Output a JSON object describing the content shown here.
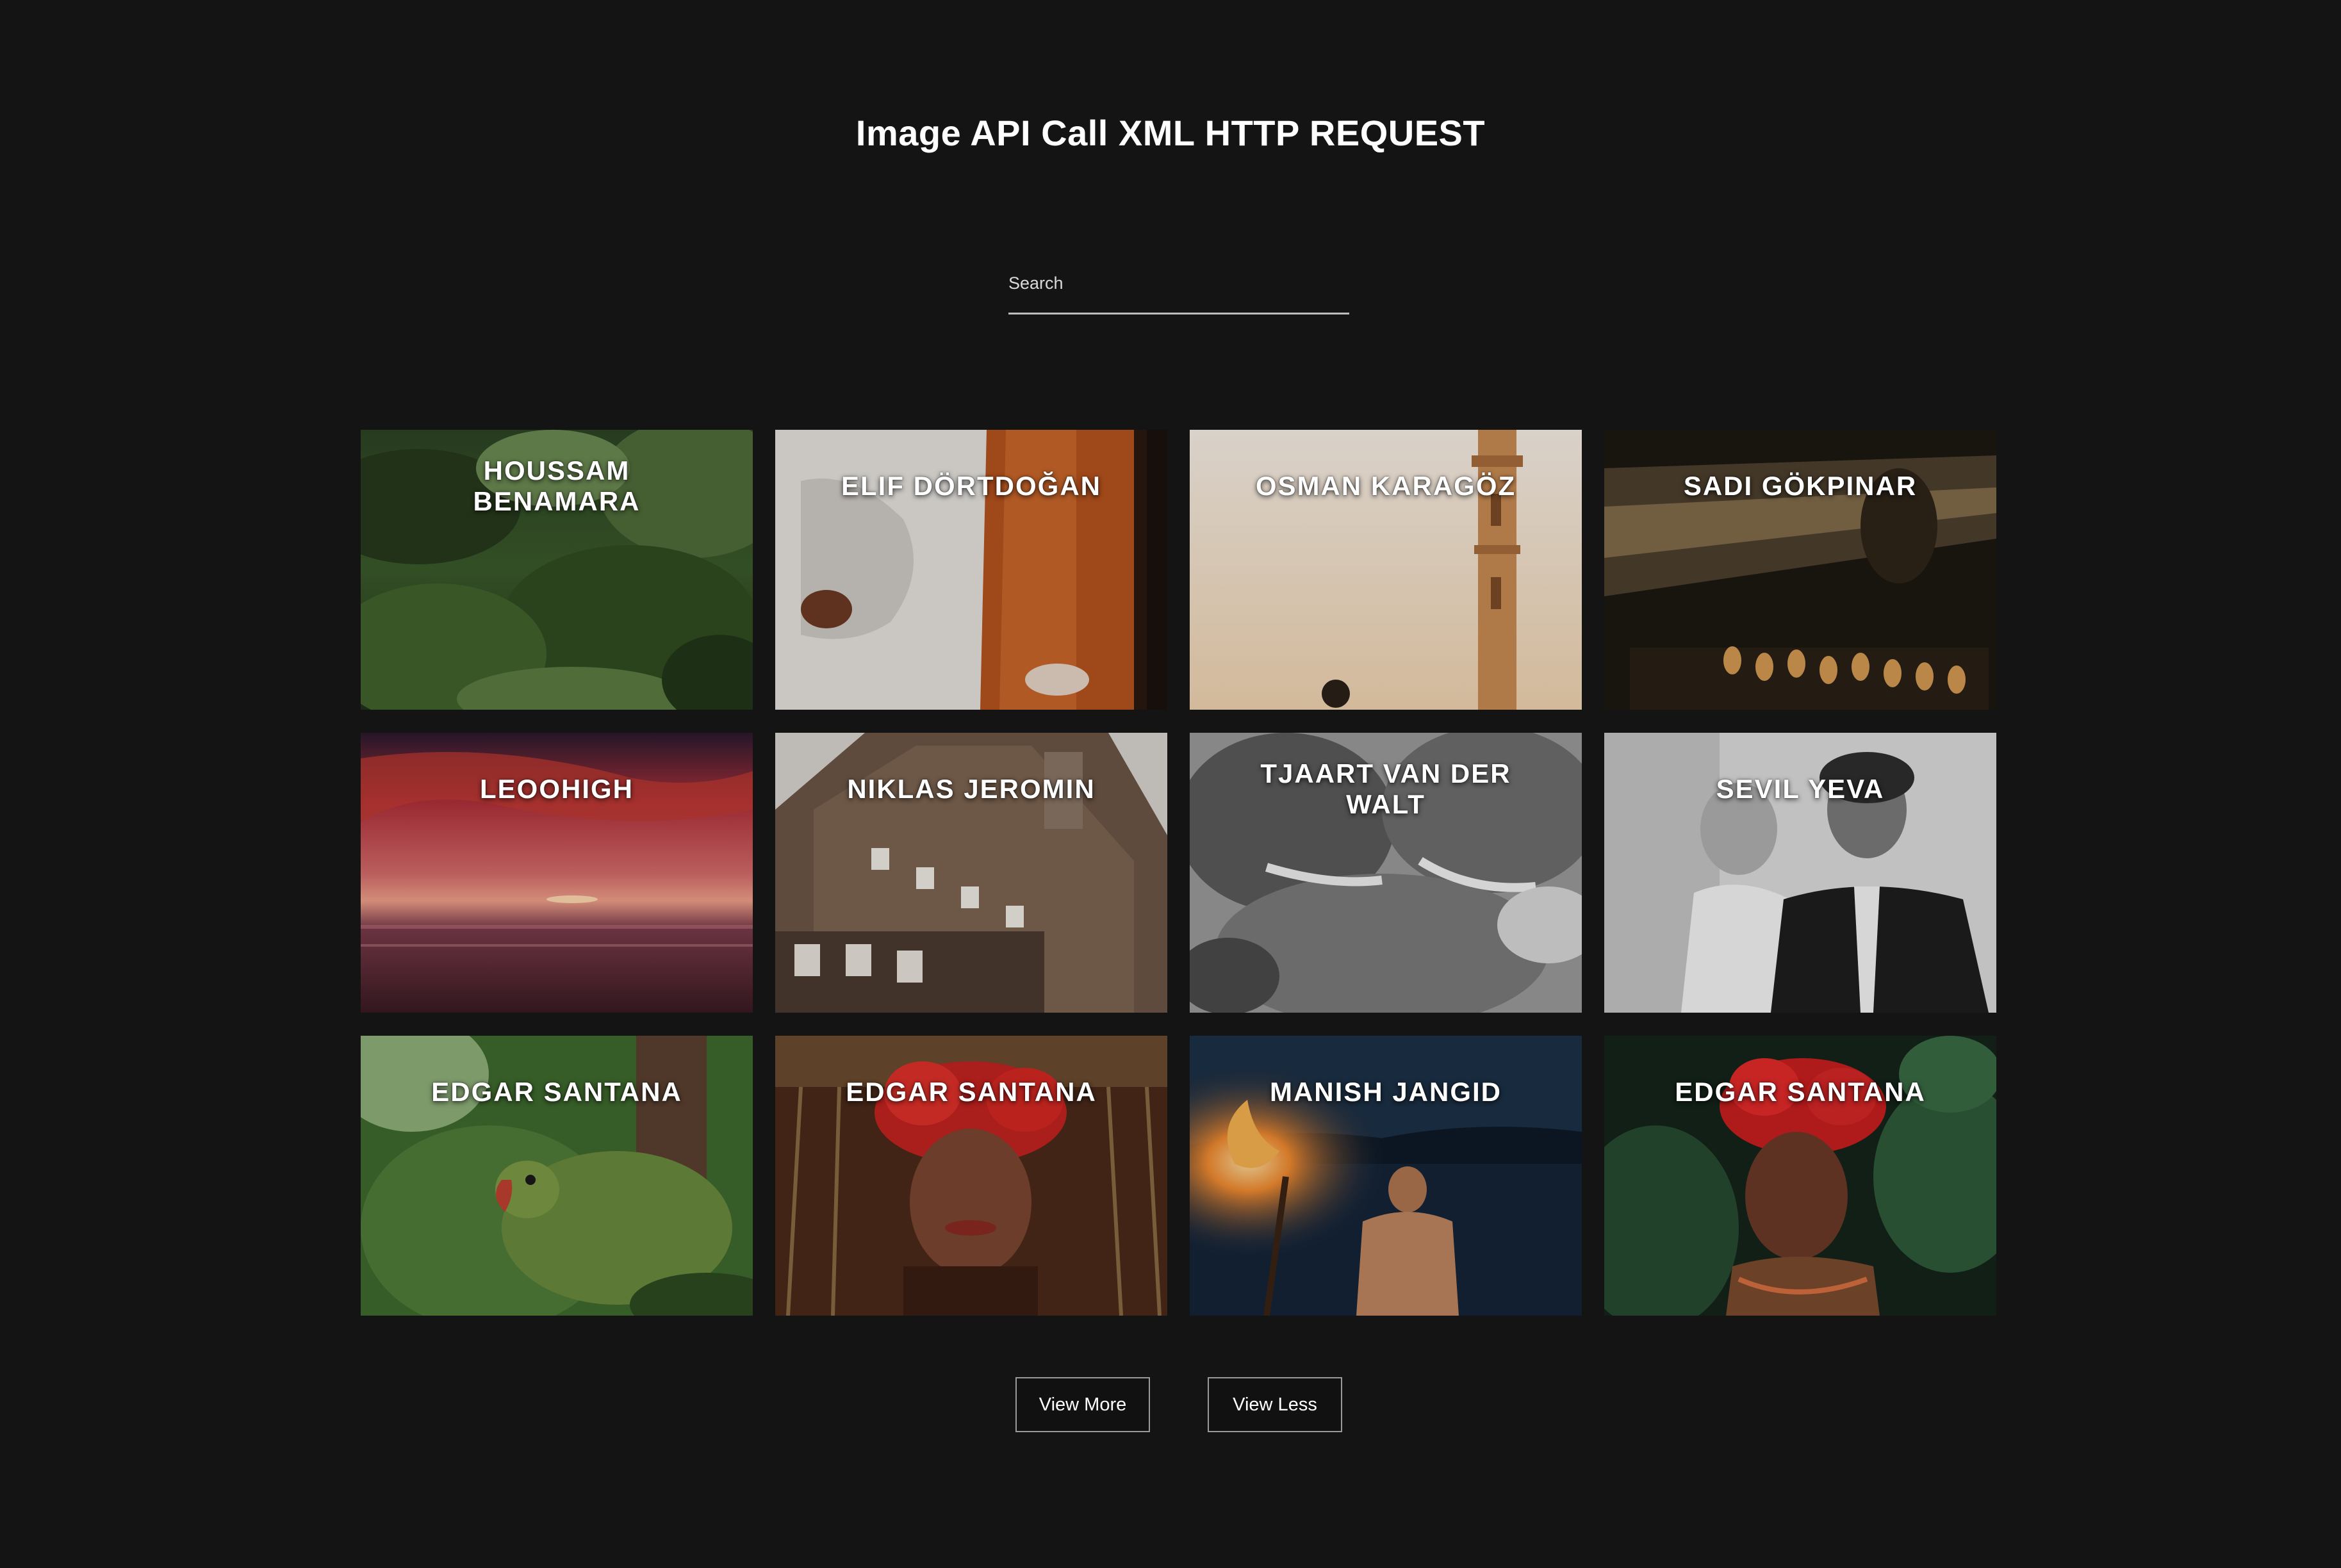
{
  "header": {
    "title": "Image API Call XML HTTP REQUEST"
  },
  "search": {
    "placeholder": "Search",
    "value": ""
  },
  "gallery": {
    "cards": [
      {
        "label": "HOUSSAM BENAMARA",
        "scene": "jungle foliage"
      },
      {
        "label": "ELIF DÖRTDOĞAN",
        "scene": "person in white shirt beside orange wall"
      },
      {
        "label": "OSMAN KARAGÖZ",
        "scene": "minaret against pale sky"
      },
      {
        "label": "SADI GÖKPINAR",
        "scene": "sunlit audience and performer"
      },
      {
        "label": "LEOOHIGH",
        "scene": "red sunset over sea"
      },
      {
        "label": "NIKLAS JEROMIN",
        "scene": "half-timbered rooftops"
      },
      {
        "label": "TJAART VAN DER WALT",
        "scene": "elephants in black and white"
      },
      {
        "label": "SEVIL YEVA",
        "scene": "couple in black and white"
      },
      {
        "label": "EDGAR SANTANA",
        "scene": "green parrot"
      },
      {
        "label": "EDGAR SANTANA",
        "scene": "woman with red flower crown"
      },
      {
        "label": "MANISH JANGID",
        "scene": "man holding torch at dusk"
      },
      {
        "label": "EDGAR SANTANA",
        "scene": "woman with red flower crown among leaves"
      }
    ]
  },
  "actions": {
    "view_more": "View More",
    "view_less": "View Less"
  },
  "colors": {
    "background": "#141414",
    "text": "#ffffff",
    "button_border": "#9a9a9a",
    "search_underline": "#bdbdbd"
  }
}
